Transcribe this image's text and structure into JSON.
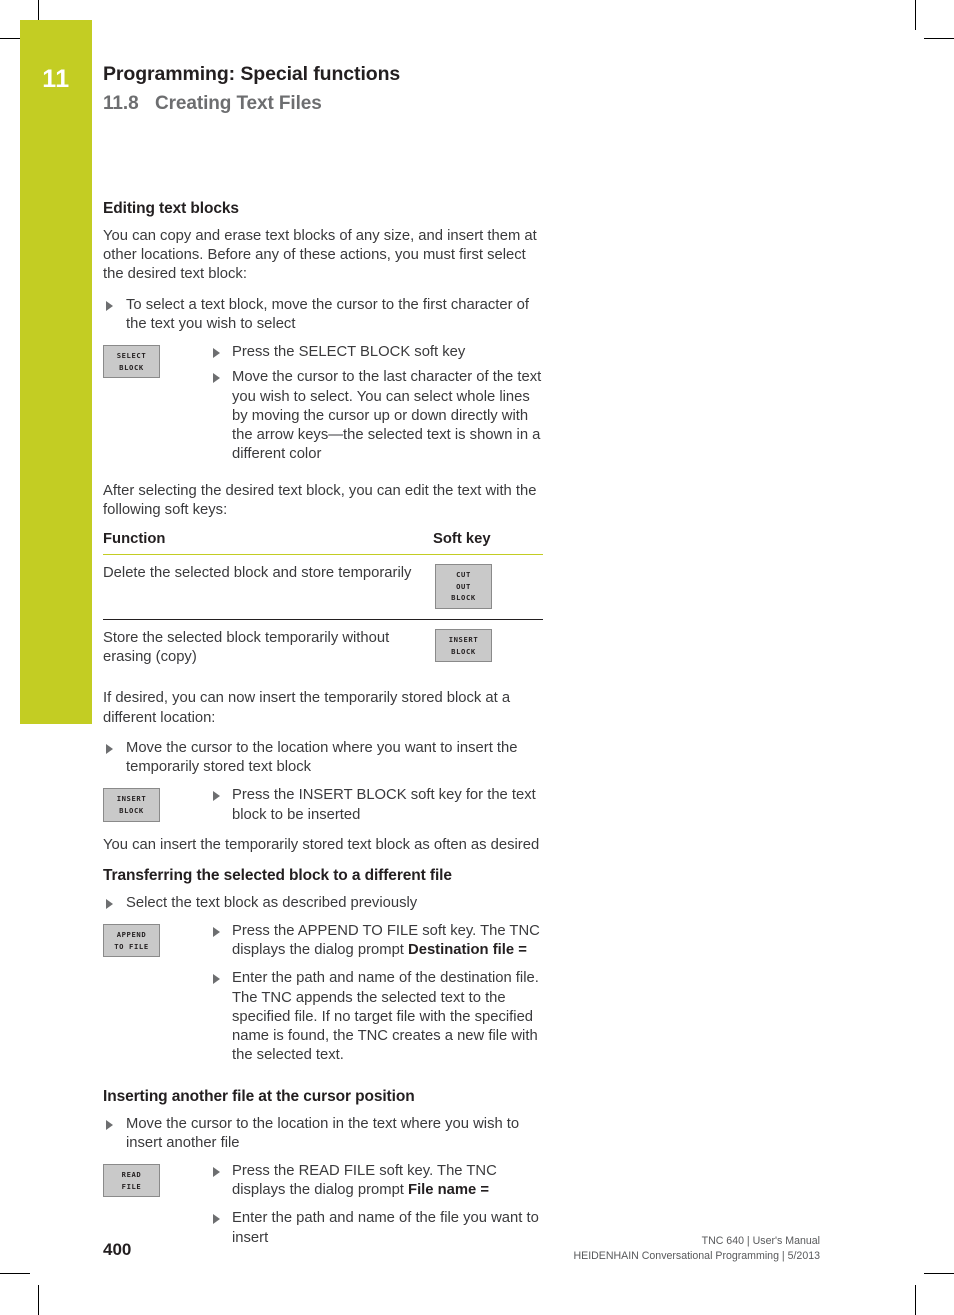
{
  "chapter": {
    "number": "11",
    "title": "Programming: Special functions",
    "section_number": "11.8",
    "section_title": "Creating Text Files",
    "tab_color": "#c3cd23"
  },
  "content": {
    "heading_editing": "Editing text blocks",
    "intro_paragraph": "You can copy and erase text blocks of any size, and insert them at other locations. Before any of these actions, you must first select the desired text block:",
    "bullet_select": "To select a text block, move the cursor to the first character of the text you wish to select",
    "softkey_select_block": {
      "line1": "SELECT",
      "line2": "BLOCK"
    },
    "bullet_press_select": "Press the SELECT BLOCK soft key",
    "bullet_move_cursor_last": "Move the cursor to the last character of the text you wish to select. You can select whole lines by moving the cursor up or down directly with the arrow keys—the selected text is shown in a different color",
    "after_selecting_paragraph": "After selecting the desired text block, you can edit the text with the following soft keys:",
    "table": {
      "headers": [
        "Function",
        "Soft key"
      ],
      "rows": [
        {
          "function": "Delete the selected block and store temporarily",
          "softkey": {
            "line1": "CUT",
            "line2": "OUT",
            "line3": "BLOCK"
          }
        },
        {
          "function": "Store the selected block temporarily without erasing (copy)",
          "softkey": {
            "line1": "INSERT",
            "line2": "BLOCK"
          }
        }
      ]
    },
    "if_desired_paragraph": "If desired, you can now insert the temporarily stored block at a different location:",
    "bullet_move_cursor_insert": "Move the cursor to the location where you want to insert the temporarily stored text block",
    "softkey_insert_block": {
      "line1": "INSERT",
      "line2": "BLOCK"
    },
    "bullet_press_insert": "Press the INSERT BLOCK soft key for the text block to be inserted",
    "you_can_insert_paragraph": "You can insert the temporarily stored text block as often as desired",
    "heading_transferring": "Transferring the selected block to a different file",
    "bullet_select_previously": "Select the text block as described previously",
    "softkey_append_to_file": {
      "line1": "APPEND",
      "line2": "TO FILE"
    },
    "bullet_press_append_pre": "Press the APPEND TO FILE soft key. The TNC displays the dialog prompt ",
    "bullet_press_append_bold": "Destination file =",
    "bullet_enter_path_destination": "Enter the path and name of the destination file. The TNC appends the selected text to the specified file. If no target file with the specified name is found, the TNC creates a new file with the selected text.",
    "heading_inserting": "Inserting another file at the cursor position",
    "bullet_move_cursor_another": "Move the cursor to the location in the text where you wish to insert another file",
    "softkey_read_file": {
      "line1": "READ",
      "line2": "FILE"
    },
    "bullet_press_read_pre": "Press the READ FILE soft key. The TNC displays the dialog prompt ",
    "bullet_press_read_bold": "File name =",
    "bullet_enter_path_insert": "Enter the path and name of the file you want to insert"
  },
  "footer": {
    "page_number": "400",
    "line1": "TNC 640 | User's Manual",
    "line2": "HEIDENHAIN Conversational Programming | 5/2013"
  }
}
